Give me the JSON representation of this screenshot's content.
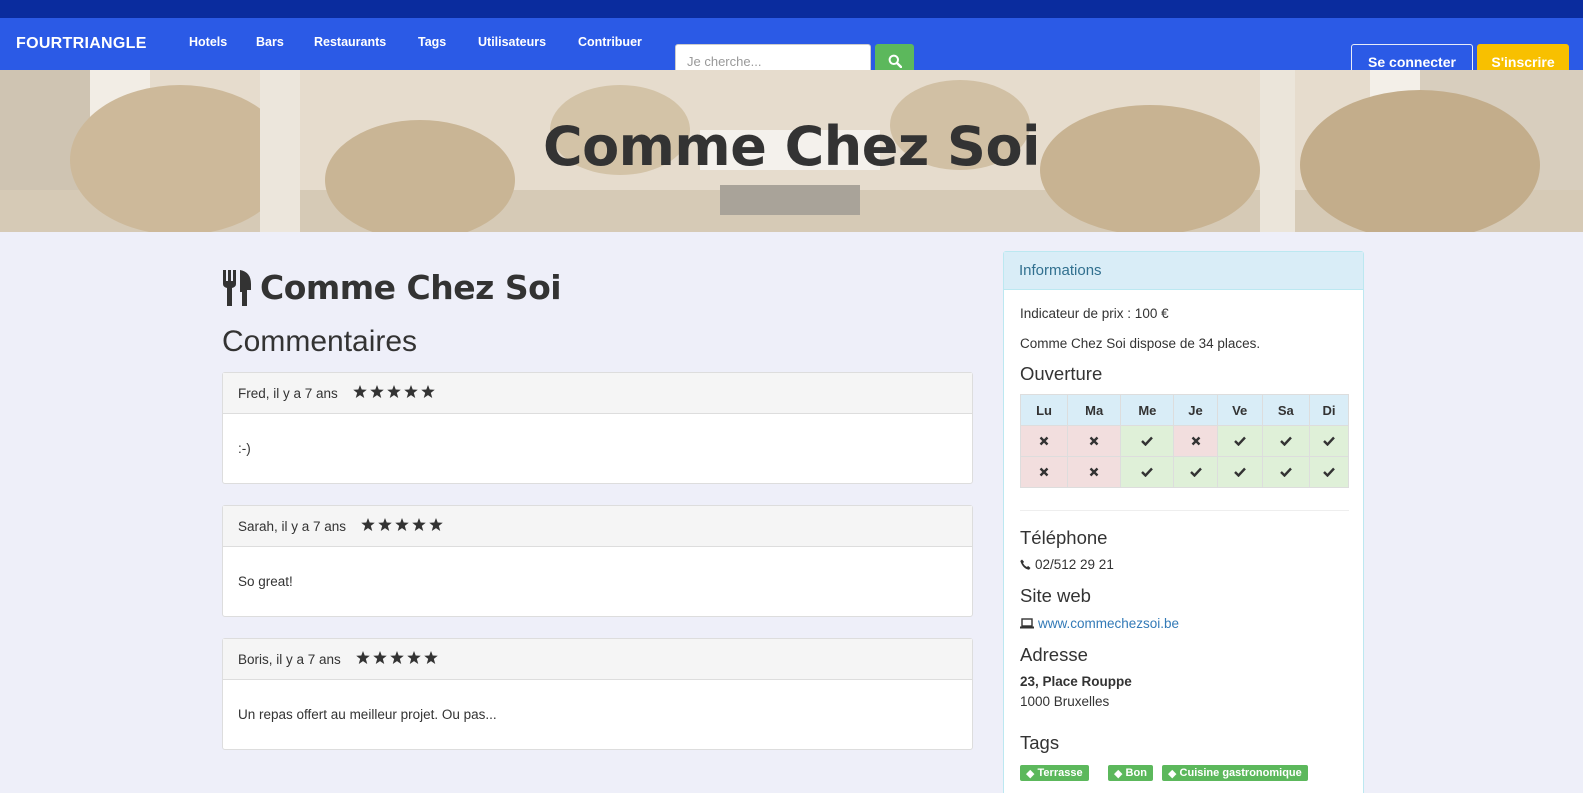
{
  "navbar": {
    "brand": "FOURTRIANGLE",
    "links": [
      "Hotels",
      "Bars",
      "Restaurants",
      "Tags",
      "Utilisateurs",
      "Contribuer"
    ],
    "search_placeholder": "Je cherche...",
    "login_label": "Se connecter",
    "signup_label": "S'inscrire"
  },
  "hero": {
    "title": "Comme Chez Soi"
  },
  "main": {
    "title": "Comme Chez Soi",
    "comments_heading": "Commentaires",
    "comments": [
      {
        "header": "Fred, il y a 7 ans",
        "stars": 5,
        "body": ":-)"
      },
      {
        "header": "Sarah, il y a 7 ans",
        "stars": 5,
        "body": "So great!"
      },
      {
        "header": "Boris, il y a 7 ans",
        "stars": 5,
        "body": "Un repas offert au meilleur projet. Ou pas..."
      }
    ]
  },
  "info": {
    "heading": "Informations",
    "price": "Indicateur de prix : 100 €",
    "places": "Comme Chez Soi dispose de 34 places.",
    "opening_heading": "Ouverture",
    "days": [
      "Lu",
      "Ma",
      "Me",
      "Je",
      "Ve",
      "Sa",
      "Di"
    ],
    "opening_rows": [
      [
        false,
        false,
        true,
        false,
        true,
        true,
        true
      ],
      [
        false,
        false,
        true,
        true,
        true,
        true,
        true
      ]
    ],
    "phone_heading": "Téléphone",
    "phone": "02/512 29 21",
    "website_heading": "Site web",
    "website": "www.commechezsoi.be",
    "address_heading": "Adresse",
    "address_street": "23, Place Rouppe",
    "address_city": "1000 Bruxelles",
    "tags_heading": "Tags",
    "tags": [
      "Terrasse",
      "Bon",
      "Cuisine gastronomique"
    ]
  },
  "colors": {
    "navbar": "#2b5ae6",
    "topstrip": "#0a2c9e",
    "signup": "#f8c000",
    "search_button": "#5cb85c",
    "tag": "#5cb85c"
  }
}
